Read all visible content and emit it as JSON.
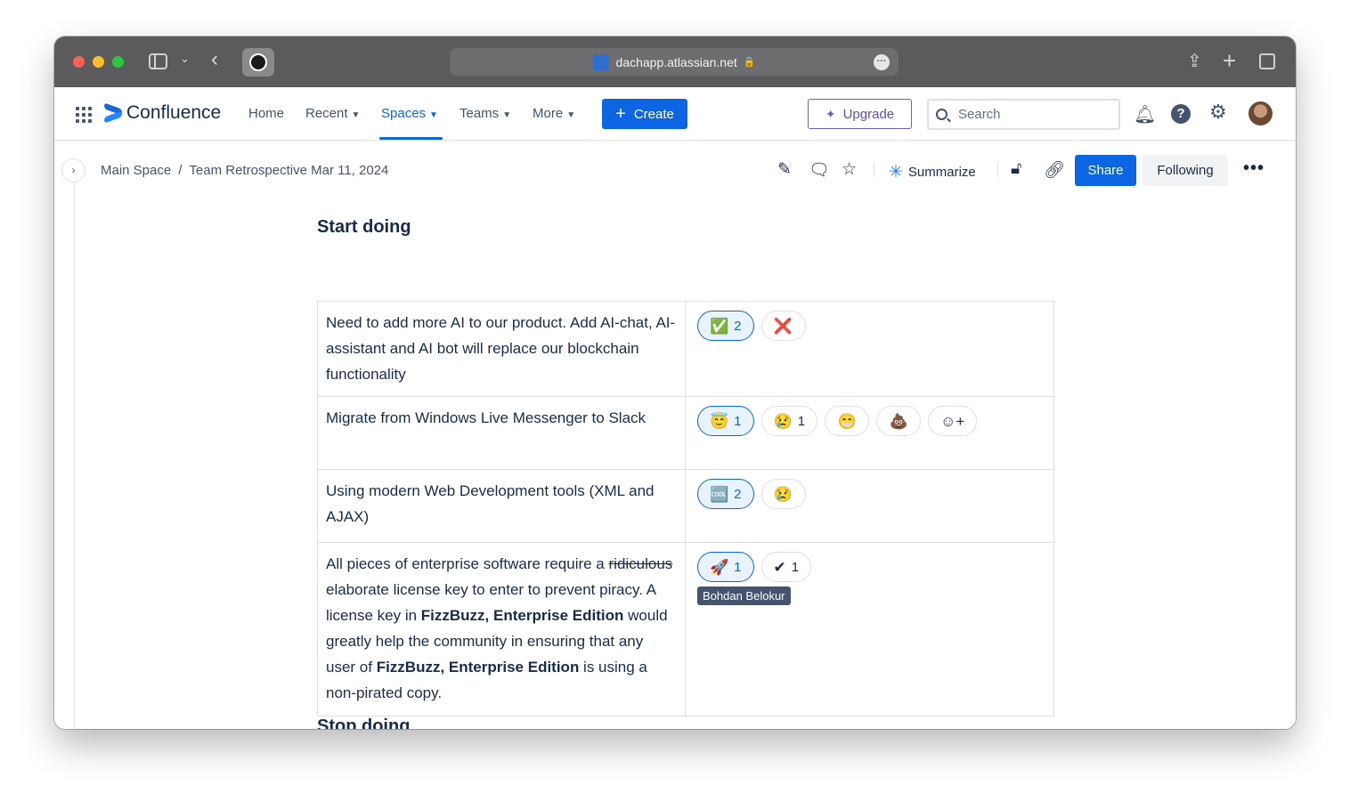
{
  "browser": {
    "url": "dachapp.atlassian.net"
  },
  "appbar": {
    "product": "Confluence",
    "nav": [
      {
        "label": "Home",
        "caret": false
      },
      {
        "label": "Recent",
        "caret": true
      },
      {
        "label": "Spaces",
        "caret": true,
        "active": true
      },
      {
        "label": "Teams",
        "caret": true
      },
      {
        "label": "More",
        "caret": true
      }
    ],
    "create_label": "Create",
    "upgrade_label": "Upgrade",
    "search_placeholder": "Search"
  },
  "page": {
    "breadcrumb": [
      "Main Space",
      "Team Retrospective Mar 11, 2024"
    ],
    "summarize_label": "Summarize",
    "share_label": "Share",
    "following_label": "Following",
    "section_title": "Start doing",
    "next_section_title": "Stop doing",
    "rows": [
      {
        "text": "Need to add more AI to our product. Add AI-chat, AI-assistant and AI bot will replace our blockchain functionality",
        "reactions": [
          {
            "emoji": "✅",
            "count": "2",
            "selected": true
          },
          {
            "emoji": "❌",
            "count": "",
            "selected": false
          }
        ]
      },
      {
        "text": "Migrate from Windows Live Messenger to Slack",
        "reactions": [
          {
            "emoji": "😇",
            "count": "1",
            "selected": true
          },
          {
            "emoji": "😢",
            "count": "1",
            "selected": false
          },
          {
            "emoji": "😁",
            "count": "",
            "selected": false
          },
          {
            "emoji": "💩",
            "count": "",
            "selected": false
          },
          {
            "emoji": "☺+",
            "count": "",
            "selected": false,
            "add": true
          }
        ]
      },
      {
        "text": "Using modern Web Development tools (XML and AJAX)",
        "reactions": [
          {
            "emoji": "🆒",
            "count": "2",
            "selected": true
          },
          {
            "emoji": "😢",
            "count": "",
            "selected": false
          }
        ]
      },
      {
        "text_parts": {
          "a": "All pieces of enterprise software require a ",
          "strike": "ridiculous",
          "b": " elaborate license key to enter to prevent piracy. A license key in ",
          "bold1": "FizzBuzz, Enterprise Edition",
          "c": " would greatly help the community in ensuring that any user of ",
          "bold2": "FizzBuzz, Enterprise Edition",
          "d": " is using a non-pirated copy."
        },
        "reactions": [
          {
            "emoji": "🚀",
            "count": "1",
            "selected": true
          },
          {
            "emoji": "✔",
            "count": "1",
            "selected": false
          }
        ],
        "tooltip": "Bohdan Belokur"
      }
    ]
  }
}
